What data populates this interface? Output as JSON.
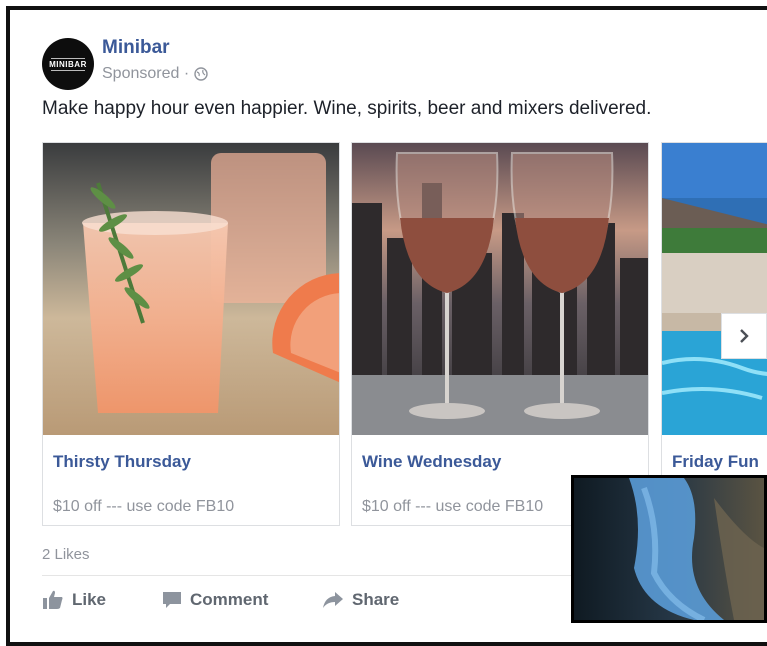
{
  "post": {
    "page_name": "Minibar",
    "avatar_text": "MINIBAR",
    "sponsored": "Sponsored ·",
    "text": "Make happy hour even happier. Wine, spirits, beer and mixers delivered."
  },
  "cards": [
    {
      "title": "Thirsty Thursday",
      "subtitle": "$10 off --- use code FB10"
    },
    {
      "title": "Wine Wednesday",
      "subtitle": "$10 off --- use code FB10"
    },
    {
      "title": "Friday Fun",
      "subtitle": ""
    }
  ],
  "footer": {
    "likes": "2 Likes",
    "like_label": "Like",
    "comment_label": "Comment",
    "share_label": "Share"
  },
  "colors": {
    "link_blue": "#3b5998",
    "meta_gray": "#90949c",
    "action_gray": "#606770"
  },
  "icons": [
    "globe-icon",
    "chevron-right-icon",
    "thumbs-up-icon",
    "comment-icon",
    "share-arrow-icon"
  ]
}
